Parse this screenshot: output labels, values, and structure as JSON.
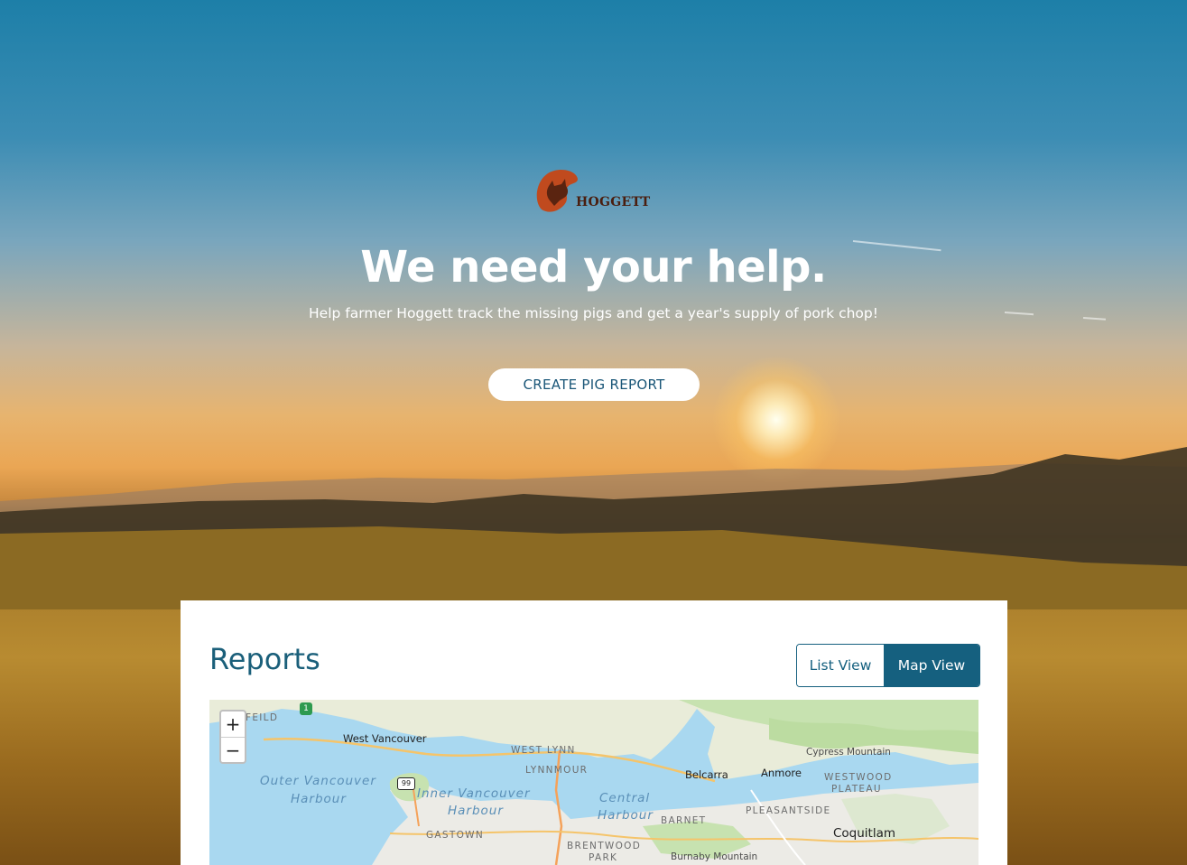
{
  "brand": {
    "name": "HOGGETT",
    "logo_icon": "pig-head-icon",
    "colors": {
      "logo": "#c04a1e",
      "primary": "#15607f"
    }
  },
  "hero": {
    "headline": "We need your help.",
    "subline": "Help farmer Hoggett track the missing pigs and get a year's supply of pork chop!",
    "cta_label": "CREATE PIG REPORT"
  },
  "reports": {
    "title": "Reports",
    "toggle": {
      "list_label": "List View",
      "map_label": "Map View",
      "selected": "Map View"
    }
  },
  "map": {
    "zoom_in": "+",
    "zoom_out": "−",
    "highway_1": "1",
    "highway_99": "99",
    "labels": {
      "feild": "FEILD",
      "west_vancouver": "West Vancouver",
      "west_lynn": "WEST LYNN",
      "lynnmour": "LYNNMOUR",
      "outer_harbour_1": "Outer Vancouver",
      "outer_harbour_2": "Harbour",
      "inner_harbour_1": "Inner Vancouver",
      "inner_harbour_2": "Harbour",
      "central_harbour_1": "Central",
      "central_harbour_2": "Harbour",
      "gastown": "GASTOWN",
      "brentwood_1": "BRENTWOOD",
      "brentwood_2": "PARK",
      "barnet": "BARNET",
      "burnaby_mountain": "Burnaby Mountain",
      "belcarra": "Belcarra",
      "anmore": "Anmore",
      "cypress_mountain": "Cypress Mountain",
      "westwood_1": "WESTWOOD",
      "westwood_2": "PLATEAU",
      "pleasantside": "PLEASANTSIDE",
      "coquitlam": "Coquitlam"
    }
  }
}
